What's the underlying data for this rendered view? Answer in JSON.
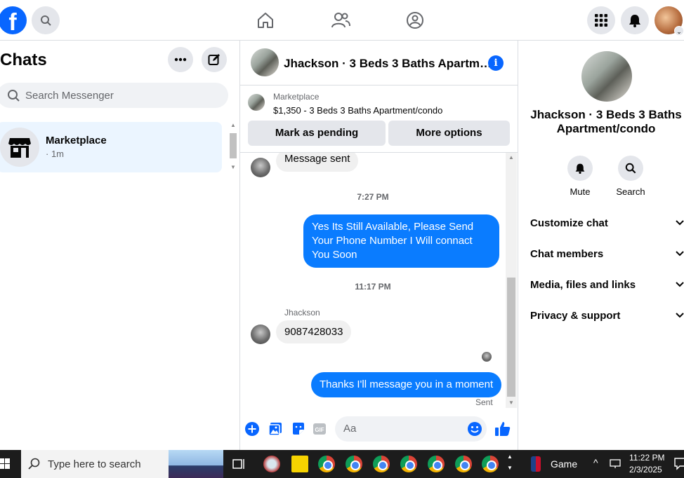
{
  "topbar": {
    "logo": "f"
  },
  "left": {
    "title": "Chats",
    "search_placeholder": "Search Messenger",
    "chat": {
      "name": "Marketplace",
      "time": "· 1m"
    }
  },
  "conversation": {
    "title": "Jhackson · 3 Beds 3 Baths Apartm…",
    "info": "i",
    "marketplace_label": "Marketplace",
    "listing": "$1,350 - 3 Beds 3 Baths Apartment/condo",
    "btn_pending": "Mark as pending",
    "btn_more": "More options",
    "messages": {
      "m1": "Message sent",
      "t1": "7:27 PM",
      "m2": "Yes Its Still Available, Please Send Your Phone Number I Will connact You Soon",
      "t2": "11:17 PM",
      "sender": "Jhackson",
      "m3": "9087428033",
      "m4": "Thanks I'll message you in a moment",
      "status": "Sent"
    },
    "composer_placeholder": "Aa"
  },
  "right": {
    "name": "Jhackson · 3 Beds 3 Baths Apartment/condo",
    "mute": "Mute",
    "search": "Search",
    "rows": [
      "Customize chat",
      "Chat members",
      "Media, files and links",
      "Privacy & support"
    ]
  },
  "taskbar": {
    "search": "Type here to search",
    "game": "Game",
    "time": "11:22 PM",
    "date": "2/3/2025"
  },
  "colors": {
    "brand": "#0866ff",
    "outgoing_bubble": "#0a7cff",
    "incoming_bubble": "#f0f0f0"
  }
}
